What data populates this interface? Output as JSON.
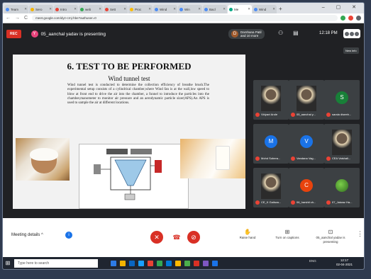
{
  "browser": {
    "tabs": [
      {
        "label": "Team",
        "color": "#4c8df6"
      },
      {
        "label": "Sero",
        "color": "#f4b400"
      },
      {
        "label": "Intro",
        "color": "#ea4335"
      },
      {
        "label": "web",
        "color": "#34a853"
      },
      {
        "label": "Sett",
        "color": "#ea4335"
      },
      {
        "label": "Proc",
        "color": "#fbbc04"
      },
      {
        "label": "Wind",
        "color": "#4c8df6"
      },
      {
        "label": "Win",
        "color": "#4c8df6"
      },
      {
        "label": "Bacl",
        "color": "#4c8df6"
      },
      {
        "label": "Me",
        "color": "#00a884",
        "active": true
      },
      {
        "label": "Wind",
        "color": "#4c8df6"
      }
    ],
    "new_tab": "+",
    "window_controls": "– ▢ ✕",
    "nav": {
      "back": "←",
      "forward": "→",
      "reload": "C"
    },
    "url": "meet.google.com/dyz-crnj-hbe?authuser=0"
  },
  "meet": {
    "rec_label": "REC",
    "presenter_initial": "Y",
    "presenting_text": "05_aanchal yadav is presenting",
    "other_presenter": {
      "initial": "D",
      "line1": "Darshana Patil",
      "line2": "and 10 more"
    },
    "time": "12:18 PM",
    "new_info": "New info",
    "slide": {
      "title": "6. TEST TO BE PERFORMED",
      "subtitle": "Wind tunnel test",
      "paragraph": "Wind tunnel test is conducted to determine the collection efficiency of breathe brush.The experimental setup consists of a cylindrical chamber,where Wind fan is at the wall,low speed to blow at front end to drive the air into the chamber, a funnel to introduce the particles into the chamber,manometer to monitor air pressure and an aerodynamic particle sizer(APS).An APS is used to sample the air at different locations."
    },
    "participants": [
      {
        "name": "Vidyavi Arole",
        "initial": "",
        "color": "#3c4043",
        "type": "photo"
      },
      {
        "name": "05_aanchal y...",
        "initial": "",
        "color": "#3c4043",
        "type": "photo"
      },
      {
        "name": "sarala diseeb...",
        "initial": "S",
        "color": "#188038",
        "type": "circle"
      },
      {
        "name": "Mohd Sobera...",
        "initial": "M",
        "color": "#1a73e8",
        "type": "circle"
      },
      {
        "name": "Vandana Vag...",
        "initial": "V",
        "color": "#1a73e8",
        "type": "circle"
      },
      {
        "name": "CEA Vaishali...",
        "initial": "",
        "color": "#3c4043",
        "type": "photo"
      },
      {
        "name": "CE_K Gaikwa...",
        "initial": "",
        "color": "#3c4043",
        "type": "photo"
      },
      {
        "name": "06_harshit ch...",
        "initial": "C",
        "color": "#e8430d",
        "type": "circle"
      },
      {
        "name": "07_Jaiwaz Ha...",
        "initial": "",
        "color": "#3c4043",
        "type": "leaf"
      }
    ],
    "controls": {
      "meeting_details": "Meeting details",
      "chevron": "^",
      "mic_icon": "✕",
      "hangup_icon": "☎",
      "cam_icon": "⊘",
      "raise_hand": "Raise hand",
      "raise_hand_icon": "✋",
      "captions": "Turn on captions",
      "captions_icon": "⊞",
      "present": "05_aanchal yadav is presenting",
      "present_icon": "⊡",
      "more_icon": "⋮"
    }
  },
  "taskbar": {
    "search_placeholder": "Type here to search",
    "tray": "ENG",
    "time": "12:17",
    "date": "02-04-2021",
    "icons": [
      "#2d7be5",
      "#f4b400",
      "#0a66c2",
      "#1aa0ff",
      "#ea4335",
      "#34a853",
      "#0078d7",
      "#ffb900",
      "#4cae4c",
      "#d93025",
      "#7e57c2",
      "#1a73e8"
    ]
  }
}
